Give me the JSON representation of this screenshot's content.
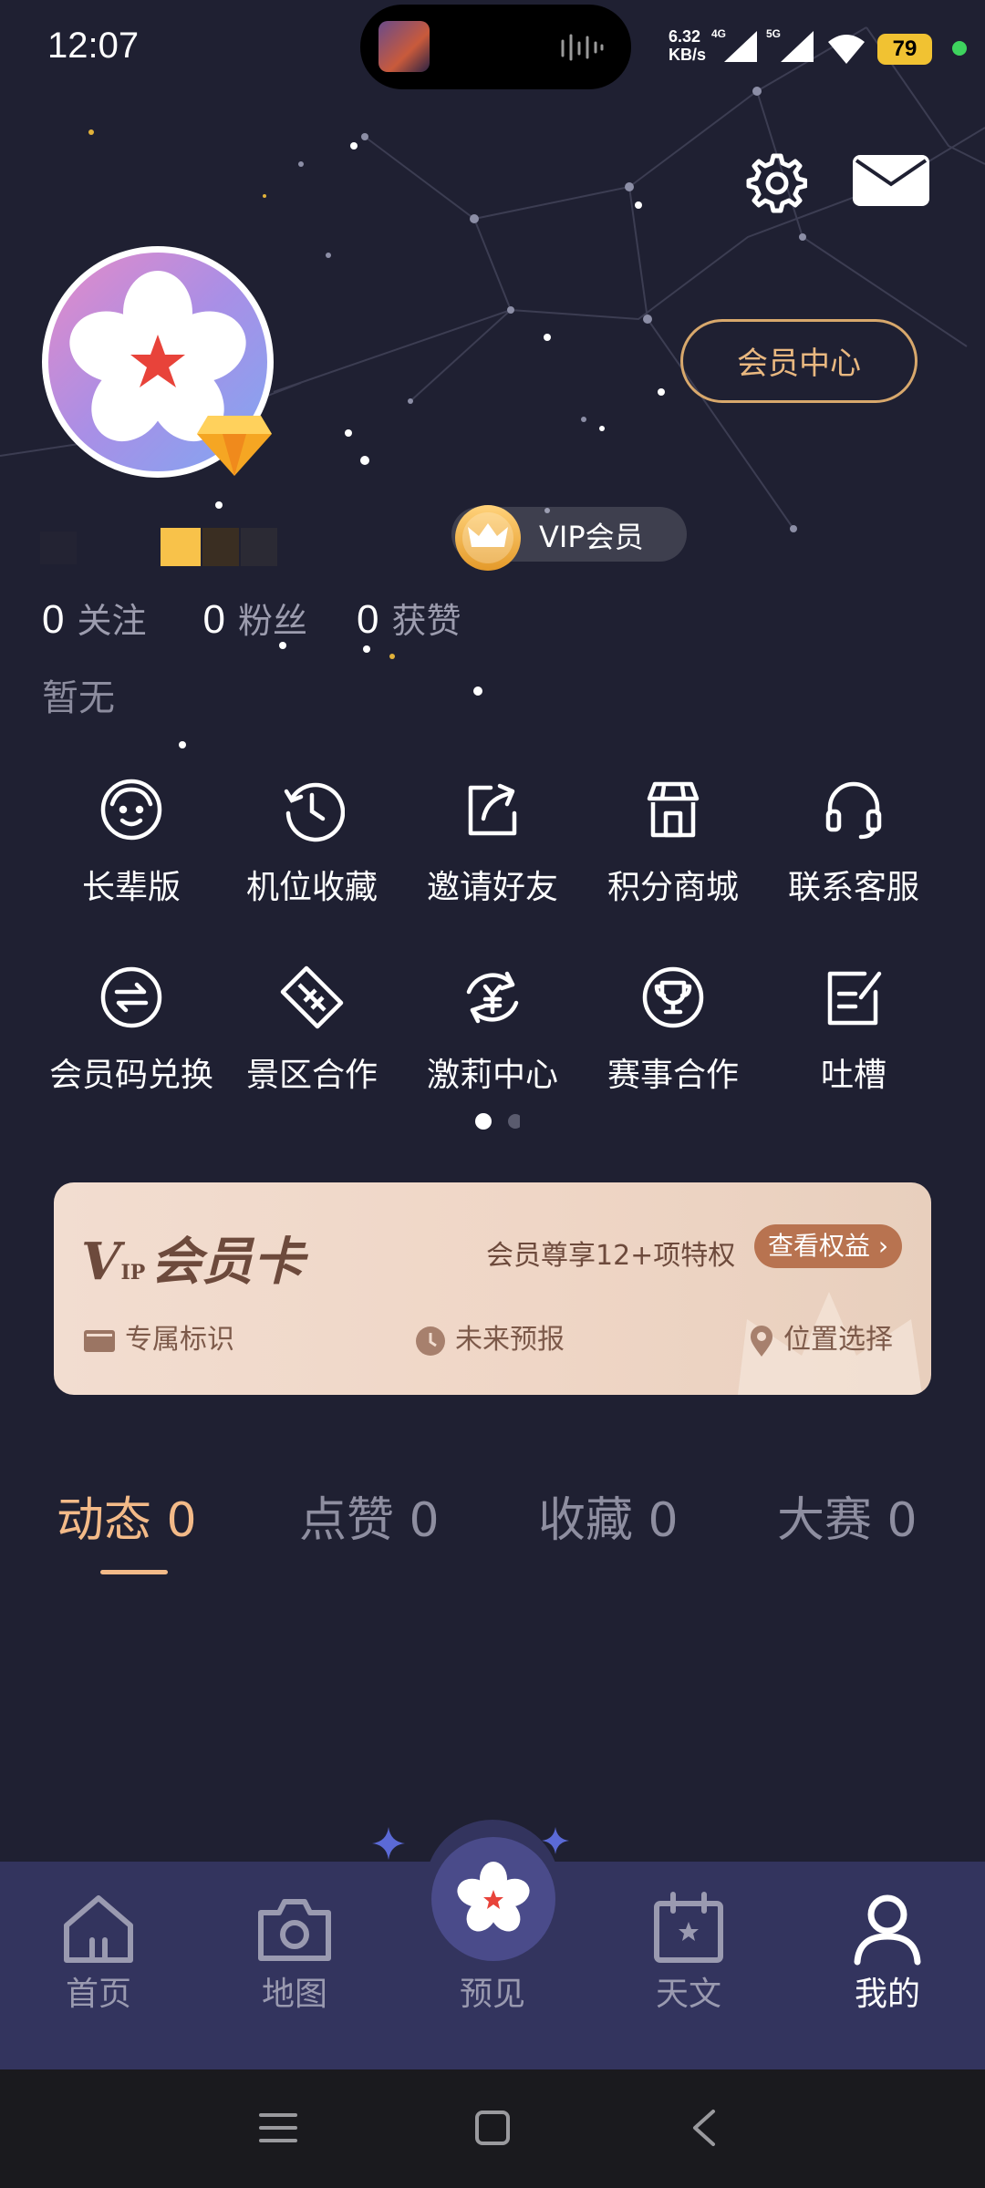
{
  "status_bar": {
    "time": "12:07",
    "net_speed_value": "6.32",
    "net_speed_unit": "KB/s",
    "sim1_label": "4G",
    "sim2_label": "5G",
    "battery": "79"
  },
  "header": {
    "settings_icon": "gear-icon",
    "mail_icon": "mail-icon",
    "member_center": "会员中心"
  },
  "profile": {
    "vip_badge": "VIP会员",
    "stats": [
      {
        "num": "0",
        "label": "关注"
      },
      {
        "num": "0",
        "label": "粉丝"
      },
      {
        "num": "0",
        "label": "获赞"
      }
    ],
    "bio": "暂无"
  },
  "grid": {
    "row1": [
      "长辈版",
      "机位收藏",
      "邀请好友",
      "积分商城",
      "联系客服"
    ],
    "row2": [
      "会员码兑换",
      "景区合作",
      "激莉中心",
      "赛事合作",
      "吐槽"
    ]
  },
  "vip_card": {
    "logo_prefix": "IP",
    "logo": "会员卡",
    "promo": "会员尊享12+项特权",
    "button": "查看权益 ›",
    "features": [
      "专属标识",
      "未来预报",
      "位置选择"
    ]
  },
  "tabs": [
    {
      "label": "动态 0",
      "active": true
    },
    {
      "label": "点赞 0",
      "active": false
    },
    {
      "label": "收藏 0",
      "active": false
    },
    {
      "label": "大赛 0",
      "active": false
    }
  ],
  "bottom_nav": {
    "items": [
      "首页",
      "地图",
      "预见",
      "天文",
      "我的"
    ]
  },
  "colors": {
    "background": "#1f2032",
    "accent": "#f3ba88",
    "nav_bg": "#33345e"
  }
}
